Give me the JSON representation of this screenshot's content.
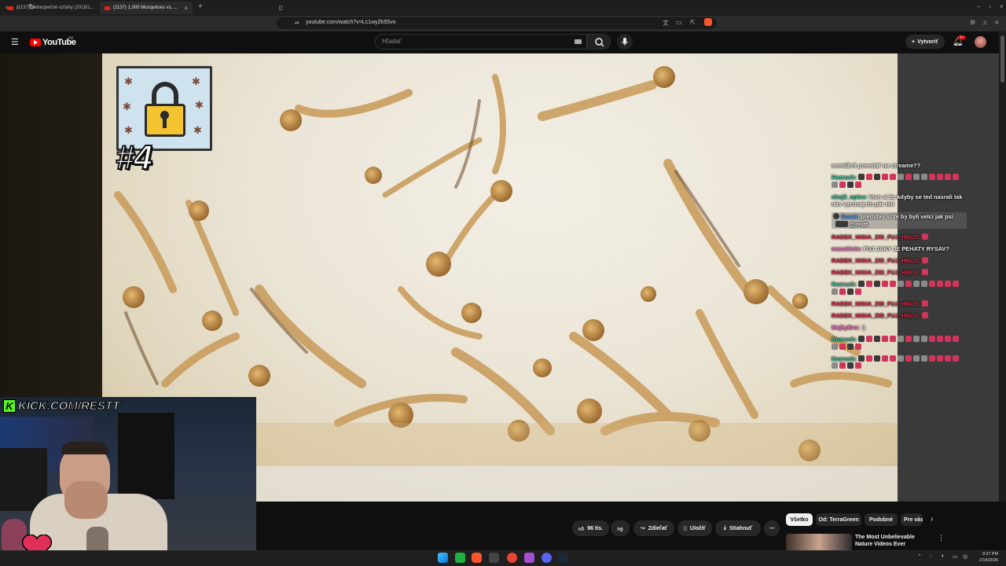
{
  "browser": {
    "tabs": [
      {
        "label": "(1137) Nebezpečné vzťahy (2018/1...",
        "active": false
      },
      {
        "label": "(1137) 1,000 Mosquitoes vs. ...",
        "active": true
      }
    ],
    "url": "youtube.com/watch?v=Lc1wyZk55vo"
  },
  "youtube": {
    "logo": "YouTube",
    "country": "SK",
    "search_placeholder": "Hľadať",
    "create_label": "Vytvoriť",
    "notifications": "9+"
  },
  "video": {
    "rank": "#4"
  },
  "stream": {
    "kick_label": "KICK.COM/RESTT"
  },
  "chat": [
    {
      "user": "",
      "text": "nemôžeš povedať na streame??",
      "user_color": "#efefef",
      "emotes": [],
      "highlight": false
    },
    {
      "user": "Rozruch:",
      "text": "",
      "user_color": "#4ec9a6",
      "emotes": [
        "b",
        "r",
        "b",
        "r",
        "r",
        "g",
        "r",
        "g",
        "g",
        "r",
        "r",
        "r",
        "r",
        "g",
        "r",
        "b",
        "r"
      ],
      "highlight": false
    },
    {
      "user": "chojil_optee:",
      "text": "Vom si že kdyby se ted nasrali tak nás vycucaj do pár dní",
      "user_color": "#4ec9a6",
      "emotes": [],
      "highlight": false
    },
    {
      "user": "Scoot:",
      "text": "predstav si že by byli velcí jak psi",
      "suffix": "@restt",
      "user_color": "#59a6ff",
      "emotes": [
        "b"
      ],
      "highlight": true
    },
    {
      "user": "RADEK_NIGIA_ZID_FUJ_HNUS:",
      "text": "",
      "user_color": "#d9304c",
      "emotes": [
        "r"
      ],
      "highlight": false
    },
    {
      "user": "maxxkinin:",
      "text": "FUJ JAKY JE PEHATY RYSAV?",
      "user_color": "#ff7fd0",
      "emotes": [],
      "highlight": false
    },
    {
      "user": "RADEK_NIGIA_ZID_FUJ_HNUS:",
      "text": "",
      "user_color": "#d9304c",
      "emotes": [
        "r"
      ],
      "highlight": false
    },
    {
      "user": "RADEK_NIGIA_ZID_FUJ_HNUS:",
      "text": "",
      "user_color": "#d9304c",
      "emotes": [
        "r"
      ],
      "highlight": false
    },
    {
      "user": "Rozruch:",
      "text": "",
      "user_color": "#4ec9a6",
      "emotes": [
        "b",
        "r",
        "b",
        "r",
        "r",
        "g",
        "r",
        "g",
        "g",
        "r",
        "r",
        "r",
        "r",
        "g",
        "r",
        "b",
        "r"
      ],
      "highlight": false
    },
    {
      "user": "RADEK_NIGIA_ZID_FUJ_HNUS:",
      "text": "",
      "user_color": "#d9304c",
      "emotes": [
        "r"
      ],
      "highlight": false
    },
    {
      "user": "RADEK_NIGIA_ZID_FUJ_HNUS:",
      "text": "",
      "user_color": "#d9304c",
      "emotes": [
        "r"
      ],
      "highlight": false
    },
    {
      "user": "MajkyBro:",
      "text": ":)",
      "user_color": "#ff7fd0",
      "emotes": [],
      "highlight": false
    },
    {
      "user": "Rozruch:",
      "text": "",
      "user_color": "#4ec9a6",
      "emotes": [
        "b",
        "r",
        "b",
        "r",
        "r",
        "g",
        "r",
        "g",
        "g",
        "r",
        "r",
        "r",
        "r",
        "g",
        "r",
        "b",
        "r"
      ],
      "highlight": false
    },
    {
      "user": "Rozruch:",
      "text": "",
      "user_color": "#4ec9a6",
      "emotes": [
        "b",
        "r",
        "b",
        "r",
        "r",
        "g",
        "r",
        "g",
        "g",
        "r",
        "r",
        "r",
        "r",
        "g",
        "r",
        "b",
        "r"
      ],
      "highlight": false
    }
  ],
  "actions": {
    "likes": "96 tis.",
    "share": "Zdieľať",
    "save": "Uložiť",
    "download": "Stiahnuť"
  },
  "chips": [
    {
      "label": "Všetko",
      "active": true
    },
    {
      "label": "Od: TerraGreen",
      "active": false
    },
    {
      "label": "Podobné",
      "active": false
    },
    {
      "label": "Pre vás",
      "active": false
    }
  ],
  "recommended": {
    "title": "The Most Unbelievable Nature Videos Ever"
  },
  "taskbar": {
    "time": "9:37 PM",
    "date": "2/14/2026"
  }
}
